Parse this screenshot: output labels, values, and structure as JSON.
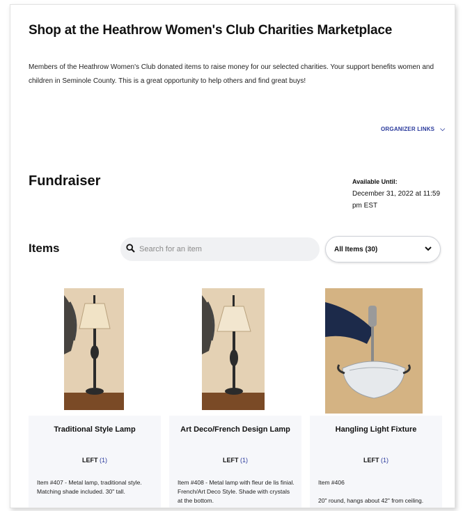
{
  "page": {
    "title": "Shop at the Heathrow Women's Club Charities Marketplace",
    "description": "Members of the Heathrow Women's Club donated items to raise money for our selected charities.  Your support benefits women and children in Seminole County.   This is a great opportunity to help others and find great buys!",
    "organizer_links": "ORGANIZER LINKS",
    "fundraiser_heading": "Fundraiser",
    "available_label": "Available Until:",
    "available_value": "December 31, 2022 at 11:59 pm EST",
    "items_heading": "Items"
  },
  "search": {
    "placeholder": "Search for an item",
    "icon": "search-icon"
  },
  "filter": {
    "selected": "All Items (30)"
  },
  "items": [
    {
      "name": "Traditional Style Lamp",
      "left_label": "LEFT",
      "left_count": "(1)",
      "description": "Item #407 - Metal lamp, traditional style. Matching shade included. 30\" tall."
    },
    {
      "name": "Art Deco/French Design Lamp",
      "left_label": "LEFT",
      "left_count": "(1)",
      "description": "Item #408 - Metal lamp with fleur de lis finial.  French/Art Deco Style.  Shade with crystals at the bottom."
    },
    {
      "name": "Hangling Light Fixture",
      "left_label": "LEFT",
      "left_count": "(1)",
      "description": "Item #406\n\n20\" round, hangs about 42\" from ceiling."
    }
  ],
  "colors": {
    "accent": "#2a3a9c",
    "panel": "#f6f7fa",
    "search_bg": "#f0f1f3"
  }
}
